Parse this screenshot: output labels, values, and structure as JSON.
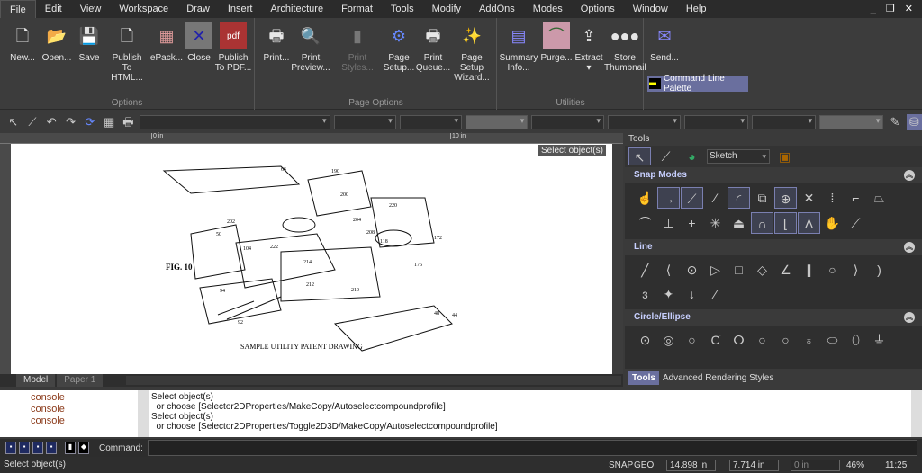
{
  "menu": [
    "File",
    "Edit",
    "View",
    "Workspace",
    "Draw",
    "Insert",
    "Architecture",
    "Format",
    "Tools",
    "Modify",
    "AddOns",
    "Modes",
    "Options",
    "Window",
    "Help"
  ],
  "window_controls": "_ ❐ ✕",
  "ribbon": {
    "groups": [
      "Options",
      "Page Options",
      "Utilities"
    ],
    "options": [
      {
        "l1": "New...",
        "l2": ""
      },
      {
        "l1": "Open...",
        "l2": ""
      },
      {
        "l1": "Save",
        "l2": ""
      },
      {
        "l1": "Publish",
        "l2": "To HTML..."
      },
      {
        "l1": "ePack...",
        "l2": ""
      },
      {
        "l1": "Close",
        "l2": ""
      },
      {
        "l1": "Publish",
        "l2": "To PDF..."
      }
    ],
    "page_options": [
      {
        "l1": "Print...",
        "l2": ""
      },
      {
        "l1": "Print",
        "l2": "Preview..."
      },
      {
        "l1": "Print Styles...",
        "l2": ""
      },
      {
        "l1": "Page",
        "l2": "Setup..."
      },
      {
        "l1": "Print",
        "l2": "Queue..."
      },
      {
        "l1": "Page Setup",
        "l2": "Wizard..."
      }
    ],
    "utilities": [
      {
        "l1": "Summary",
        "l2": "Info..."
      },
      {
        "l1": "Purge...",
        "l2": ""
      },
      {
        "l1": "Extract",
        "l2": "▾"
      },
      {
        "l1": "Store",
        "l2": "Thumbnail"
      },
      {
        "l1": "Send...",
        "l2": ""
      }
    ],
    "command_line_palette": "Command Line Palette"
  },
  "ruler": {
    "mark0": "0 in",
    "mark10": "10 in"
  },
  "tooltip": "Select object(s)",
  "drawing": {
    "fig": "FIG. 10",
    "title": "SAMPLE UTILITY PATENT DRAWING",
    "labels": [
      "66",
      "202",
      "50",
      "104",
      "222",
      "92",
      "94",
      "200",
      "204",
      "208",
      "220",
      "48",
      "44",
      "172",
      "176",
      "210",
      "212",
      "214",
      "190",
      "118"
    ]
  },
  "layout_tabs": [
    "Model",
    "Paper 1"
  ],
  "tools_panel": {
    "title": "Tools",
    "mode": "Sketch",
    "sections": [
      "Snap Modes",
      "Line",
      "Circle/Ellipse"
    ],
    "bottom_tabs": [
      "Tools",
      "Advanced Rendering Styles"
    ]
  },
  "console": {
    "tree": [
      "console",
      "console",
      "console"
    ],
    "lines": [
      "Select object(s)",
      "  or choose [Selector2DProperties/MakeCopy/Autoselectcompoundprofile]",
      "Select object(s)",
      "  or choose [Selector2DProperties/Toggle2D3D/MakeCopy/Autoselectcompoundprofile]"
    ]
  },
  "command": {
    "label": "Command:",
    "value": ""
  },
  "status": {
    "message": "Select object(s)",
    "snap": "SNAP",
    "geo": "GEO",
    "x": "14.898 in",
    "y": "7.714 in",
    "z": "0 in",
    "zoom": "46%",
    "time": "11:25"
  }
}
